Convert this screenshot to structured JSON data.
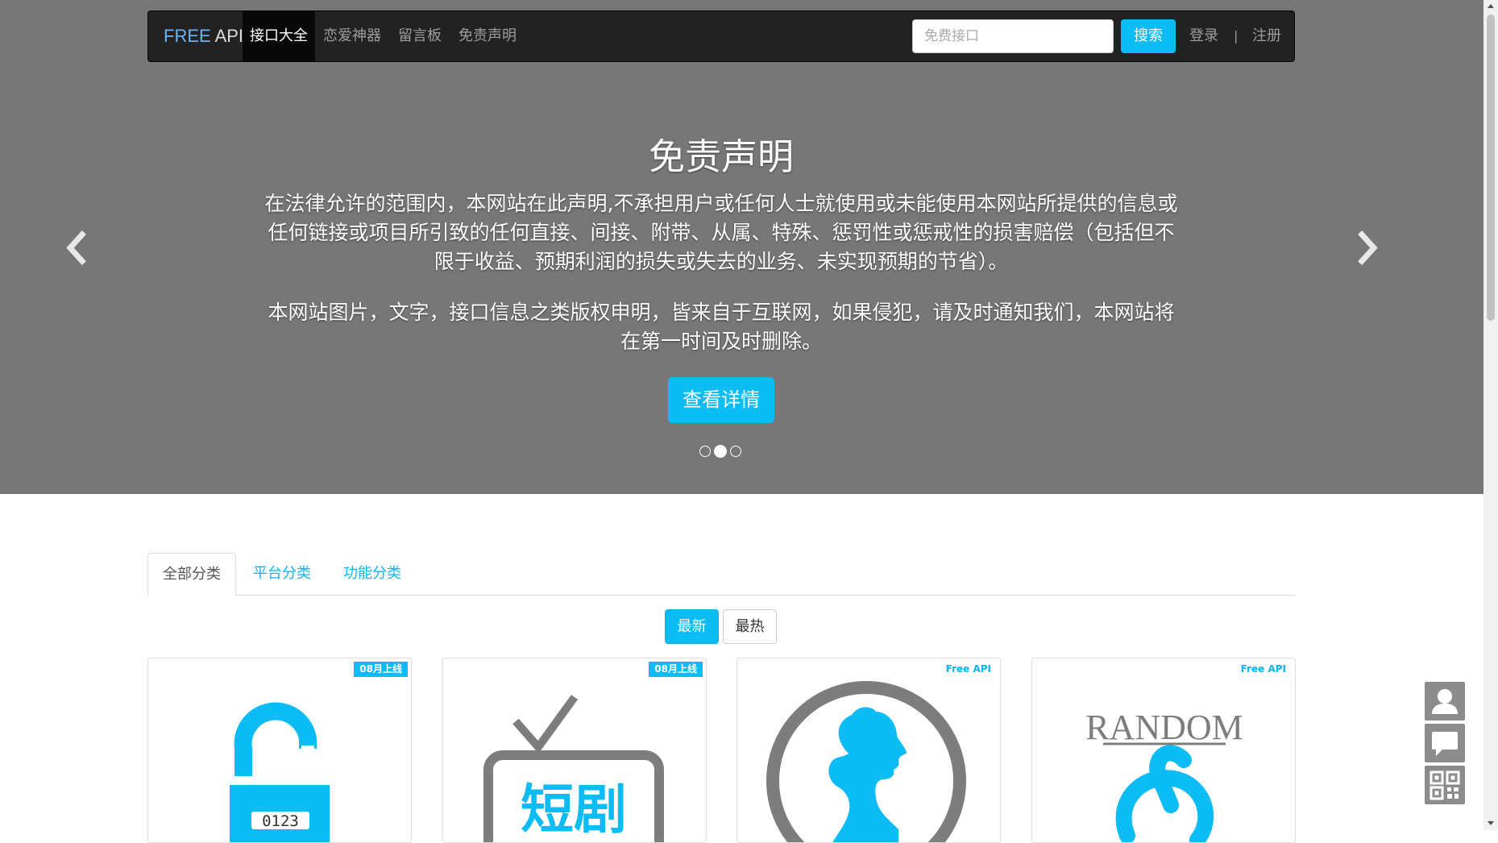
{
  "navbar": {
    "brand_free": "FREE",
    "brand_api": " API",
    "items": [
      {
        "label": "接口大全",
        "active": true
      },
      {
        "label": "恋爱神器",
        "active": false
      },
      {
        "label": "留言板",
        "active": false
      },
      {
        "label": "免责声明",
        "active": false
      }
    ],
    "search_placeholder": "免费接口",
    "search_button": "搜索",
    "login": "登录",
    "separator": "|",
    "register": "注册"
  },
  "hero": {
    "title": "免责声明",
    "paragraph1": "在法律允许的范围内，本网站在此声明,不承担用户或任何人士就使用或未能使用本网站所提供的信息或任何链接或项目所引致的任何直接、间接、附带、从属、特殊、惩罚性或惩戒性的损害赔偿（包括但不限于收益、预期利润的损失或失去的业务、未实现预期的节省）。",
    "paragraph2": "本网站图片，文字，接口信息之类版权申明，皆来自于互联网，如果侵犯，请及时通知我们，本网站将在第一时间及时删除。",
    "button": "查看详情",
    "slides": 3,
    "active_slide": 2,
    "arrow_left_icon": "chevron-left-icon",
    "arrow_right_icon": "chevron-right-icon"
  },
  "tabs": [
    {
      "label": "全部分类",
      "active": true
    },
    {
      "label": "平台分类",
      "active": false
    },
    {
      "label": "功能分类",
      "active": false
    }
  ],
  "sort": {
    "newest": "最新",
    "hottest": "最热"
  },
  "cards": [
    {
      "badge": "08月上线",
      "badge_style": "filled",
      "icon": "unlock-icon",
      "image_text": "0123"
    },
    {
      "badge": "08月上线",
      "badge_style": "filled",
      "icon": "tv-short-drama-icon",
      "image_text": "短剧"
    },
    {
      "badge": "Free API",
      "badge_style": "text",
      "icon": "woman-silhouette-icon",
      "image_text": ""
    },
    {
      "badge": "Free API",
      "badge_style": "text",
      "icon": "random-netease-icon",
      "image_text": "RANDOM"
    }
  ],
  "float_buttons": [
    "user-icon",
    "message-icon",
    "qrcode-icon"
  ],
  "colors": {
    "accent": "#0bbcf5",
    "hero_bg": "#777777",
    "navbar_bg": "#222222",
    "icon_gray": "#7d7d7d"
  }
}
